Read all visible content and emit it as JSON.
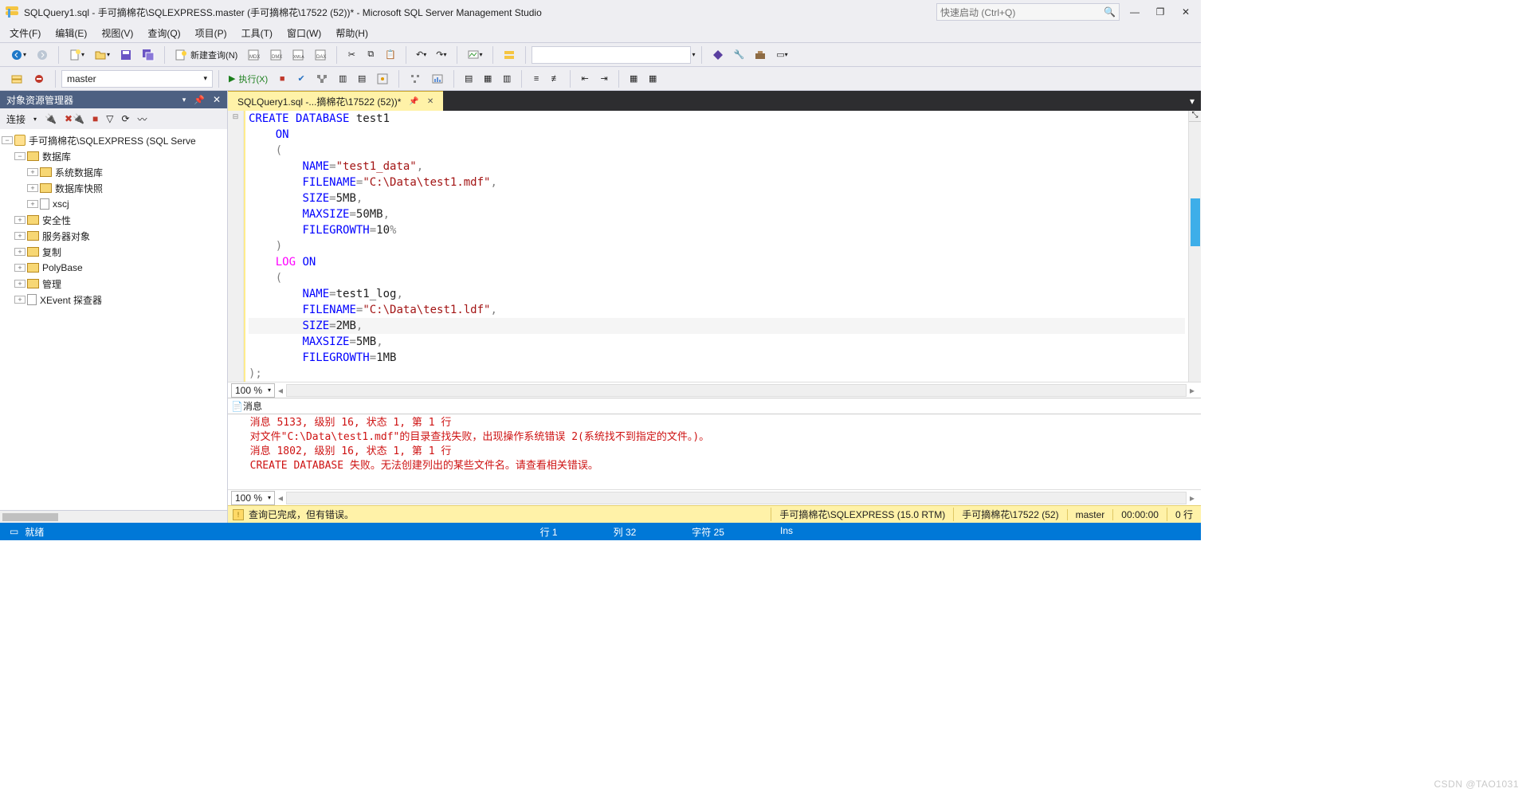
{
  "title_bar": {
    "title": "SQLQuery1.sql - 手可摘棉花\\SQLEXPRESS.master (手可摘棉花\\17522 (52))* - Microsoft SQL Server Management Studio",
    "quick_launch_placeholder": "快速启动 (Ctrl+Q)"
  },
  "menu": {
    "file": "文件(F)",
    "edit": "编辑(E)",
    "view": "视图(V)",
    "query": "查询(Q)",
    "project": "项目(P)",
    "tools": "工具(T)",
    "window": "窗口(W)",
    "help": "帮助(H)"
  },
  "toolbar1": {
    "new_query": "新建查询(N)"
  },
  "toolbar2": {
    "db": "master",
    "execute": "执行(X)"
  },
  "explorer": {
    "title": "对象资源管理器",
    "connect": "连接",
    "server": "手可摘棉花\\SQLEXPRESS (SQL Serve",
    "nodes": {
      "databases": "数据库",
      "sysdb": "系统数据库",
      "dbsnapshot": "数据库快照",
      "xscj": "xscj",
      "security": "安全性",
      "server_obj": "服务器对象",
      "replication": "复制",
      "polybase": "PolyBase",
      "management": "管理",
      "xevent": "XEvent 探查器"
    }
  },
  "tab": {
    "label": "SQLQuery1.sql -...摘棉花\\17522 (52))*"
  },
  "code_tokens": [
    {
      "indent": 0,
      "parts": [
        {
          "t": "CREATE",
          "c": "kw-blue"
        },
        {
          "t": " "
        },
        {
          "t": "DATABASE",
          "c": "kw-blue"
        },
        {
          "t": " test1"
        }
      ]
    },
    {
      "indent": 1,
      "parts": [
        {
          "t": "ON",
          "c": "kw-blue"
        }
      ]
    },
    {
      "indent": 1,
      "parts": [
        {
          "t": "(",
          "c": "kw-gray"
        }
      ]
    },
    {
      "indent": 2,
      "parts": [
        {
          "t": "NAME",
          "c": "kw-blue"
        },
        {
          "t": "=",
          "c": "kw-gray"
        },
        {
          "t": "\"test1_data\"",
          "c": "kw-str"
        },
        {
          "t": ",",
          "c": "kw-gray"
        }
      ]
    },
    {
      "indent": 2,
      "parts": [
        {
          "t": "FILENAME",
          "c": "kw-blue"
        },
        {
          "t": "=",
          "c": "kw-gray"
        },
        {
          "t": "\"C:\\Data\\test1.mdf\"",
          "c": "kw-str"
        },
        {
          "t": ",",
          "c": "kw-gray"
        }
      ]
    },
    {
      "indent": 2,
      "parts": [
        {
          "t": "SIZE",
          "c": "kw-blue"
        },
        {
          "t": "=",
          "c": "kw-gray"
        },
        {
          "t": "5MB"
        },
        {
          "t": ",",
          "c": "kw-gray"
        }
      ]
    },
    {
      "indent": 2,
      "parts": [
        {
          "t": "MAXSIZE",
          "c": "kw-blue"
        },
        {
          "t": "=",
          "c": "kw-gray"
        },
        {
          "t": "50MB"
        },
        {
          "t": ",",
          "c": "kw-gray"
        }
      ]
    },
    {
      "indent": 2,
      "parts": [
        {
          "t": "FILEGROWTH",
          "c": "kw-blue"
        },
        {
          "t": "=",
          "c": "kw-gray"
        },
        {
          "t": "10"
        },
        {
          "t": "%",
          "c": "kw-gray"
        }
      ]
    },
    {
      "indent": 1,
      "parts": [
        {
          "t": ")",
          "c": "kw-gray"
        }
      ]
    },
    {
      "indent": 1,
      "parts": [
        {
          "t": "LOG",
          "c": "kw-magenta"
        },
        {
          "t": " "
        },
        {
          "t": "ON",
          "c": "kw-blue"
        }
      ]
    },
    {
      "indent": 1,
      "parts": [
        {
          "t": "(",
          "c": "kw-gray"
        }
      ]
    },
    {
      "indent": 2,
      "parts": [
        {
          "t": "NAME",
          "c": "kw-blue"
        },
        {
          "t": "=",
          "c": "kw-gray"
        },
        {
          "t": "test1_log"
        },
        {
          "t": ",",
          "c": "kw-gray"
        }
      ]
    },
    {
      "indent": 2,
      "parts": [
        {
          "t": "FILENAME",
          "c": "kw-blue"
        },
        {
          "t": "=",
          "c": "kw-gray"
        },
        {
          "t": "\"C:\\Data\\test1.ldf\"",
          "c": "kw-str"
        },
        {
          "t": ",",
          "c": "kw-gray"
        }
      ]
    },
    {
      "indent": 2,
      "current": true,
      "parts": [
        {
          "t": "SIZE",
          "c": "kw-blue"
        },
        {
          "t": "=",
          "c": "kw-gray"
        },
        {
          "t": "2MB"
        },
        {
          "t": ",",
          "c": "kw-gray"
        }
      ]
    },
    {
      "indent": 2,
      "parts": [
        {
          "t": "MAXSIZE",
          "c": "kw-blue"
        },
        {
          "t": "=",
          "c": "kw-gray"
        },
        {
          "t": "5MB"
        },
        {
          "t": ",",
          "c": "kw-gray"
        }
      ]
    },
    {
      "indent": 2,
      "parts": [
        {
          "t": "FILEGROWTH",
          "c": "kw-blue"
        },
        {
          "t": "=",
          "c": "kw-gray"
        },
        {
          "t": "1MB"
        }
      ]
    },
    {
      "indent": 0,
      "parts": [
        {
          "t": ");",
          "c": "kw-gray"
        }
      ]
    }
  ],
  "zoom": {
    "value": "100 %",
    "value2": "100 %"
  },
  "messages": {
    "tab": "消息",
    "lines": [
      "消息 5133, 级别 16, 状态 1, 第 1 行",
      "对文件\"C:\\Data\\test1.mdf\"的目录查找失败，出现操作系统错误 2(系统找不到指定的文件。)。",
      "消息 1802, 级别 16, 状态 1, 第 1 行",
      "CREATE DATABASE 失败。无法创建列出的某些文件名。请查看相关错误。"
    ]
  },
  "status_query": {
    "text": "查询已完成，但有错误。",
    "server": "手可摘棉花\\SQLEXPRESS (15.0 RTM)",
    "user": "手可摘棉花\\17522 (52)",
    "db": "master",
    "time": "00:00:00",
    "rows": "0 行"
  },
  "status_app": {
    "ready": "就绪",
    "line": "行 1",
    "col": "列 32",
    "char": "字符 25",
    "ins": "Ins"
  },
  "watermark": "CSDN @TAO1031"
}
